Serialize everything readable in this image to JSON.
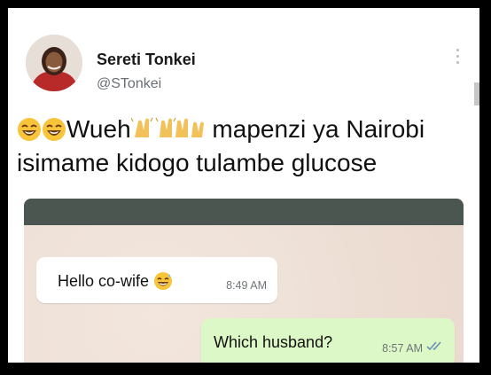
{
  "post": {
    "author_name": "Sereti Tonkei",
    "author_handle": "@STonkei",
    "text_part1": "Wueh",
    "text_part2": " mapenzi ya Nairobi",
    "text_line2": "isimame kidogo tulambe glucose"
  },
  "icons": {
    "avatar": "profile-photo",
    "more": "more-options-icon",
    "laugh_emoji": "face-with-tears-of-joy-emoji",
    "raised_hands_emoji": "raised-hands-emoji",
    "grin_emoji": "grinning-sweat-emoji",
    "read_ticks": "double-check-icon"
  },
  "chat": {
    "incoming": {
      "text": "Hello co-wife",
      "time": "8:49 AM"
    },
    "outgoing": {
      "text": "Which husband?",
      "time": "8:57 AM"
    }
  },
  "colors": {
    "outgoing_bubble": "#dcf8c6",
    "incoming_bubble": "#ffffff",
    "chat_header": "#4b5650",
    "read_ticks": "#4a90e2"
  }
}
